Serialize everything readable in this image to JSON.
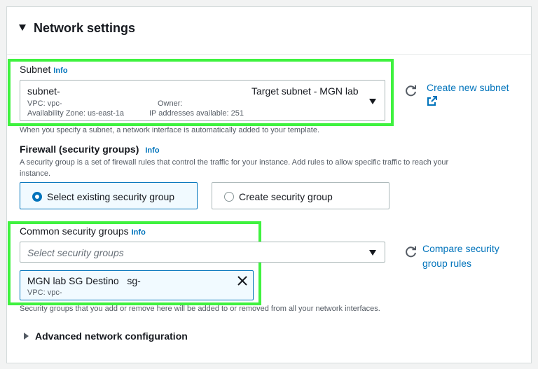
{
  "section": {
    "title": "Network settings"
  },
  "subnet": {
    "label": "Subnet",
    "info": "Info",
    "selected_id": "subnet-",
    "selected_name": "Target subnet - MGN lab",
    "vpc": "VPC: vpc-",
    "owner": "Owner:",
    "availability_zone": "Availability Zone: us-east-1a",
    "ip_available": "IP addresses available: 251",
    "hint": "When you specify a subnet, a network interface is automatically added to your template.",
    "create_link": "Create new subnet"
  },
  "firewall": {
    "label": "Firewall (security groups)",
    "info": "Info",
    "description_line1": "A security group is a set of firewall rules that control the traffic for your instance. Add rules to allow specific traffic to reach your",
    "description_line2": "instance.",
    "options": [
      {
        "label": "Select existing security group",
        "selected": true
      },
      {
        "label": "Create security group",
        "selected": false
      }
    ]
  },
  "common_sg": {
    "label": "Common security groups",
    "info": "Info",
    "placeholder": "Select security groups",
    "compare_link_line1": "Compare security",
    "compare_link_line2": "group rules",
    "token": {
      "name": "MGN lab SG Destino",
      "id": "sg-",
      "vpc": "VPC: vpc-"
    },
    "hint": "Security groups that you add or remove here will be added to or removed from all your network interfaces."
  },
  "advanced": {
    "label": "Advanced network configuration"
  },
  "colors": {
    "accent": "#0073bb",
    "highlight": "#3ff23f"
  },
  "icons": [
    "caret-down-icon",
    "refresh-icon",
    "external-link-icon",
    "close-icon",
    "caret-right-icon"
  ]
}
